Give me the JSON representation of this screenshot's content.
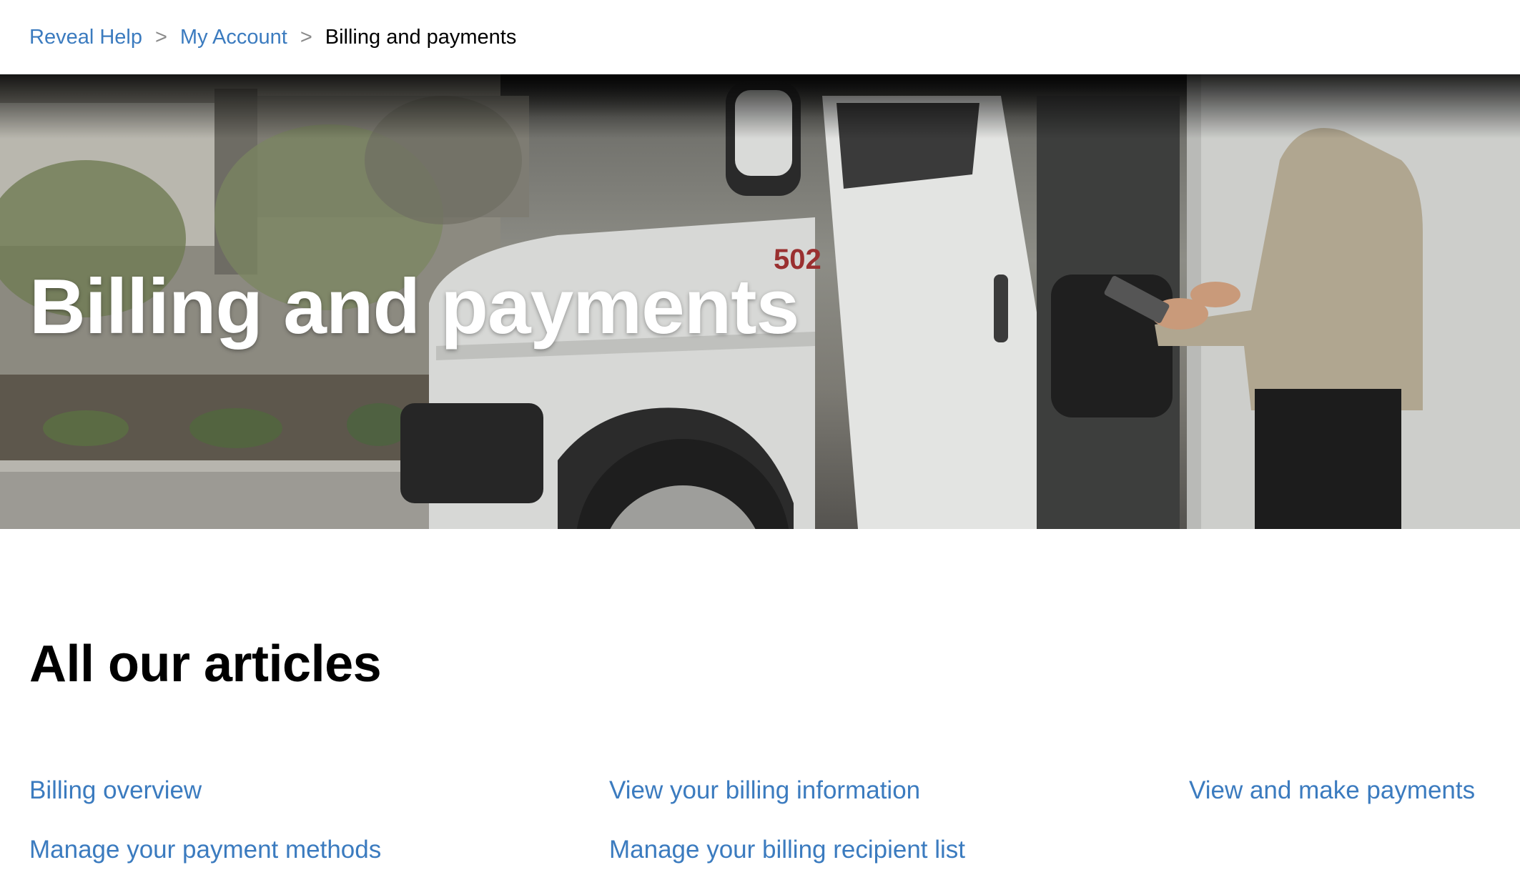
{
  "breadcrumb": {
    "items": [
      "Reveal Help",
      "My Account"
    ],
    "separator": ">",
    "current": "Billing and payments"
  },
  "hero": {
    "title": "Billing and payments",
    "van_number": "502"
  },
  "section": {
    "title": "All our articles"
  },
  "articles": [
    [
      "Billing overview",
      "View your billing information",
      "View and make payments"
    ],
    [
      "Manage your payment methods",
      "Manage your billing recipient list"
    ]
  ],
  "colors": {
    "link": "#3b7bbf",
    "text": "#000000",
    "background": "#ffffff"
  }
}
